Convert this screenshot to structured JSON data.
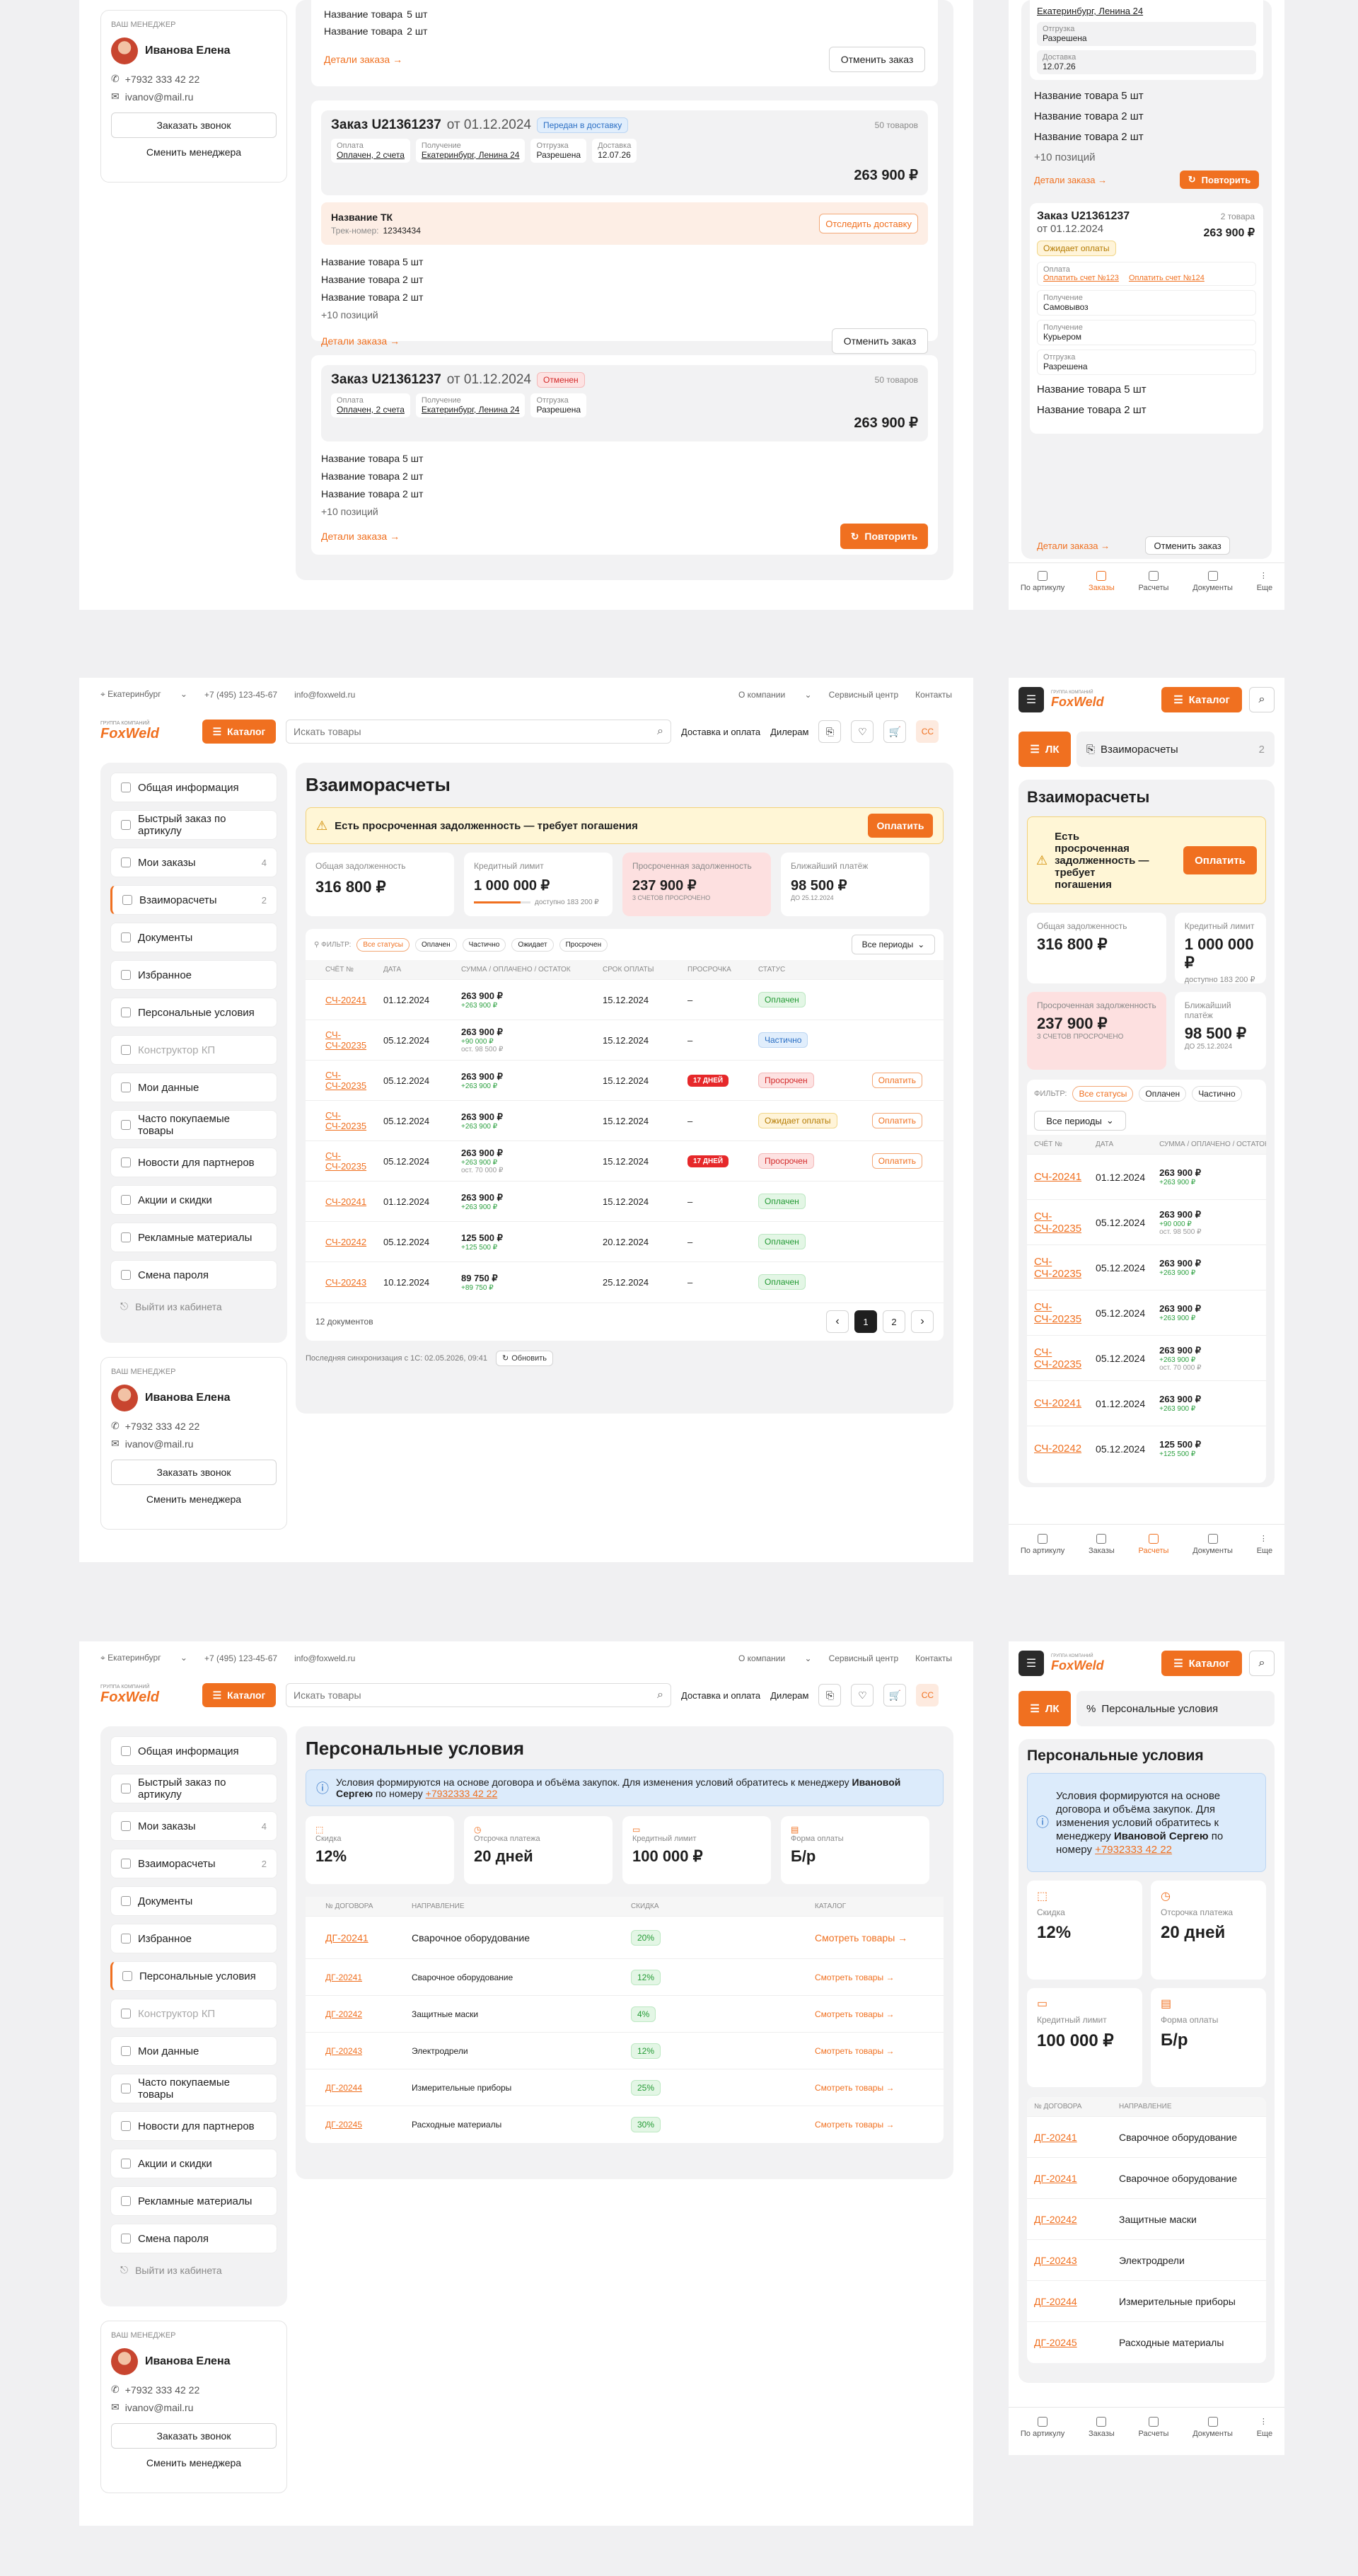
{
  "brand": {
    "logo_small": "ГРУППА КОМПАНИЙ",
    "logo": "FoxWeld",
    "accent": "#f07020"
  },
  "topbar": {
    "city": "Екатеринбург",
    "phone": "+7 (495) 123-45-67",
    "email": "info@foxweld.ru",
    "links": [
      "О компании",
      "Сервисный центр",
      "Контакты"
    ]
  },
  "header": {
    "catalog": "Каталог",
    "search_placeholder": "Искать товары",
    "links": [
      "Доставка и оплата",
      "Дилерам"
    ],
    "avatar": "CC"
  },
  "sidebar": {
    "items": [
      {
        "label": "Общая информация",
        "count": ""
      },
      {
        "label": "Быстрый заказ по артикулу",
        "count": ""
      },
      {
        "label": "Мои заказы",
        "count": "4"
      },
      {
        "label": "Взаиморасчеты",
        "count": "2"
      },
      {
        "label": "Документы",
        "count": ""
      },
      {
        "label": "Избранное",
        "count": ""
      },
      {
        "label": "Персональные условия",
        "count": ""
      },
      {
        "label": "Конструктор КП",
        "count": ""
      },
      {
        "label": "Мои данные",
        "count": ""
      },
      {
        "label": "Часто покупаемые товары",
        "count": ""
      },
      {
        "label": "Новости для партнеров",
        "count": ""
      },
      {
        "label": "Акции и скидки",
        "count": ""
      },
      {
        "label": "Рекламные материалы",
        "count": ""
      },
      {
        "label": "Смена пароля",
        "count": ""
      }
    ],
    "logout": "Выйти из кабинета"
  },
  "manager": {
    "title": "ВАШ МЕНЕДЖЕР",
    "name": "Иванова Елена",
    "phone": "+7932 333 42 22",
    "email": "ivanov@mail.ru",
    "call": "Заказать звонок",
    "change": "Сменить менеджера"
  },
  "orders": {
    "product_lines": [
      "Название товара",
      "Название товара",
      "Название товара"
    ],
    "qty": [
      "5 шт",
      "2 шт",
      "2 шт"
    ],
    "more": "+10 позиций",
    "details": "Детали заказа",
    "cancel": "Отменить заказ",
    "repeat": "Повторить",
    "top_lines": [
      "Название товара",
      "Название товара"
    ],
    "top_qty": [
      "5 шт",
      "2 шт"
    ],
    "o1": {
      "title": "Заказ U21361237",
      "date": "от 01.12.2024",
      "status": "Передан в доставку",
      "count": "50 товаров",
      "sum": "263 900 ₽",
      "pay_l": "Оплата",
      "pay": "Оплачен, 2 счета",
      "get_l": "Получение",
      "get": "Екатеринбург, Ленина 24",
      "ship_l": "Отгрузка",
      "ship": "Разрешена",
      "del_l": "Доставка",
      "del": "12.07.26",
      "tk": "Название ТК",
      "track_l": "Трек-номер:",
      "track": "12343434",
      "track_btn": "Отследить доставку"
    },
    "o2": {
      "title": "Заказ U21361237",
      "date": "от 01.12.2024",
      "status": "Отменен",
      "count": "50 товаров",
      "sum": "263 900 ₽",
      "pay": "Оплачен, 2 счета",
      "get": "Екатеринбург, Ленина 24",
      "ship": "Разрешена"
    }
  },
  "m_orders": {
    "addr": "Екатеринбург, Ленина 24",
    "ship_l": "Отгрузка",
    "ship": "Разрешена",
    "del_l": "Доставка",
    "del": "12.07.26",
    "lines": [
      "Название товара",
      "Название товара",
      "Название товара"
    ],
    "qty": [
      "5 шт",
      "2 шт",
      "2 шт"
    ],
    "more": "+10 позиций",
    "details": "Детали заказа",
    "repeat": "Повторить",
    "cancel": "Отменить заказ",
    "o": {
      "title": "Заказ U21361237",
      "date": "от 01.12.2024",
      "count": "2 товара",
      "sum": "263 900 ₽",
      "status": "Ожидает оплаты",
      "pay_l": "Оплата",
      "pay1": "Оплатить счет №123",
      "pay2": "Оплатить счет №124",
      "get_l": "Получение",
      "get": "Самовывоз",
      "get2": "Курьером",
      "ship_l": "Отгрузка",
      "ship": "Разрешена"
    },
    "lines2": [
      "Название товара",
      "Название товара"
    ],
    "qty2": [
      "5 шт",
      "2 шт"
    ]
  },
  "mtabs": [
    "По артикулу",
    "Заказы",
    "Расчеты",
    "Документы",
    "Еще"
  ],
  "mtab_counts": [
    "",
    "4",
    "2",
    "",
    ""
  ],
  "settlements": {
    "title": "Взаиморасчеты",
    "alert": "Есть просроченная задолженность — требует погашения",
    "pay": "Оплатить",
    "stats": [
      {
        "label": "Общая задолженность",
        "value": "316 800 ₽",
        "sub": ""
      },
      {
        "label": "Кредитный лимит",
        "value": "1 000 000 ₽",
        "sub": "доступно 183 200 ₽"
      },
      {
        "label": "Просроченная задолженность",
        "value": "237 900 ₽",
        "sub": "3 СЧЕТОВ ПРОСРОЧЕНО"
      },
      {
        "label": "Ближайший платёж",
        "value": "98 500 ₽",
        "sub": "ДО 25.12.2024"
      }
    ],
    "filter_label": "ФИЛЬТР:",
    "filters": [
      "Все статусы",
      "Оплачен",
      "Частично",
      "Ожидает",
      "Просрочен"
    ],
    "period": "Все периоды",
    "cols": [
      "СЧЁТ №",
      "ДАТА",
      "СУММА / ОПЛАЧЕНО / ОСТАТОК",
      "СРОК ОПЛАТЫ",
      "ПРОСРОЧКА",
      "СТАТУС"
    ],
    "rows": [
      {
        "num": "СЧ-20241",
        "date": "01.12.2024",
        "sum": "263 900 ₽",
        "paid": "+263 900 ₽",
        "rest": "",
        "due": "15.12.2024",
        "over": "–",
        "status": "Оплачен",
        "st": "green",
        "btn": ""
      },
      {
        "num": "СЧ-СЧ-20235",
        "date": "05.12.2024",
        "sum": "263 900 ₽",
        "paid": "+90 000 ₽",
        "rest": "ост. 98 500 ₽",
        "due": "15.12.2024",
        "over": "–",
        "status": "Частично",
        "st": "blue",
        "btn": ""
      },
      {
        "num": "СЧ-СЧ-20235",
        "date": "05.12.2024",
        "sum": "263 900 ₽",
        "paid": "+263 900 ₽",
        "rest": "",
        "due": "15.12.2024",
        "over": "17 ДНЕЙ",
        "status": "Просрочен",
        "st": "redl",
        "btn": "Оплатить"
      },
      {
        "num": "СЧ-СЧ-20235",
        "date": "05.12.2024",
        "sum": "263 900 ₽",
        "paid": "+263 900 ₽",
        "rest": "",
        "due": "15.12.2024",
        "over": "–",
        "status": "Ожидает оплаты",
        "st": "yel",
        "btn": "Оплатить"
      },
      {
        "num": "СЧ-СЧ-20235",
        "date": "05.12.2024",
        "sum": "263 900 ₽",
        "paid": "+263 900 ₽",
        "rest": "ост. 70 000 ₽",
        "due": "15.12.2024",
        "over": "17 ДНЕЙ",
        "status": "Просрочен",
        "st": "redl",
        "btn": "Оплатить"
      },
      {
        "num": "СЧ-20241",
        "date": "01.12.2024",
        "sum": "263 900 ₽",
        "paid": "+263 900 ₽",
        "rest": "",
        "due": "15.12.2024",
        "over": "–",
        "status": "Оплачен",
        "st": "green",
        "btn": ""
      },
      {
        "num": "СЧ-20242",
        "date": "05.12.2024",
        "sum": "125 500 ₽",
        "paid": "+125 500 ₽",
        "rest": "",
        "due": "20.12.2024",
        "over": "–",
        "status": "Оплачен",
        "st": "green",
        "btn": ""
      },
      {
        "num": "СЧ-20243",
        "date": "10.12.2024",
        "sum": "89 750 ₽",
        "paid": "+89 750 ₽",
        "rest": "",
        "due": "25.12.2024",
        "over": "–",
        "status": "Оплачен",
        "st": "green",
        "btn": ""
      }
    ],
    "total": "12 документов",
    "pages": [
      "1",
      "2"
    ],
    "sync": "Последняя синхронизация с 1С: 02.05.2026, 09:41",
    "refresh": "Обновить"
  },
  "conditions": {
    "title": "Персональные условия",
    "info_a": "Условия формируются на основе договора и объёма закупок. Для изменения условий обратитесь к менеджеру",
    "info_name": "Ивановой Сергею",
    "info_b": "по номеру",
    "info_phone": "+7932333 42 22",
    "stats": [
      {
        "label": "Скидка",
        "value": "12%"
      },
      {
        "label": "Отсрочка платежа",
        "value": "20 дней"
      },
      {
        "label": "Кредитный лимит",
        "value": "100 000 ₽"
      },
      {
        "label": "Форма оплаты",
        "value": "Б/р"
      }
    ],
    "cols": [
      "№ ДОГОВОРА",
      "НАПРАВЛЕНИЕ",
      "СКИДКА",
      "КАТАЛОГ"
    ],
    "rows": [
      {
        "num": "ДГ-20241",
        "dir": "Сварочное оборудование",
        "disc": "20%",
        "link": "Смотреть товары"
      },
      {
        "num": "ДГ-20241",
        "dir": "Сварочное оборудование",
        "disc": "12%",
        "link": "Смотреть товары"
      },
      {
        "num": "ДГ-20242",
        "dir": "Защитные маски",
        "disc": "4%",
        "link": "Смотреть товары"
      },
      {
        "num": "ДГ-20243",
        "dir": "Электродрели",
        "disc": "12%",
        "link": "Смотреть товары"
      },
      {
        "num": "ДГ-20244",
        "dir": "Измерительные приборы",
        "disc": "25%",
        "link": "Смотреть товары"
      },
      {
        "num": "ДГ-20245",
        "dir": "Расходные материалы",
        "disc": "30%",
        "link": "Смотреть товары"
      }
    ]
  },
  "mobile": {
    "lk": "ЛК",
    "count": "2"
  }
}
